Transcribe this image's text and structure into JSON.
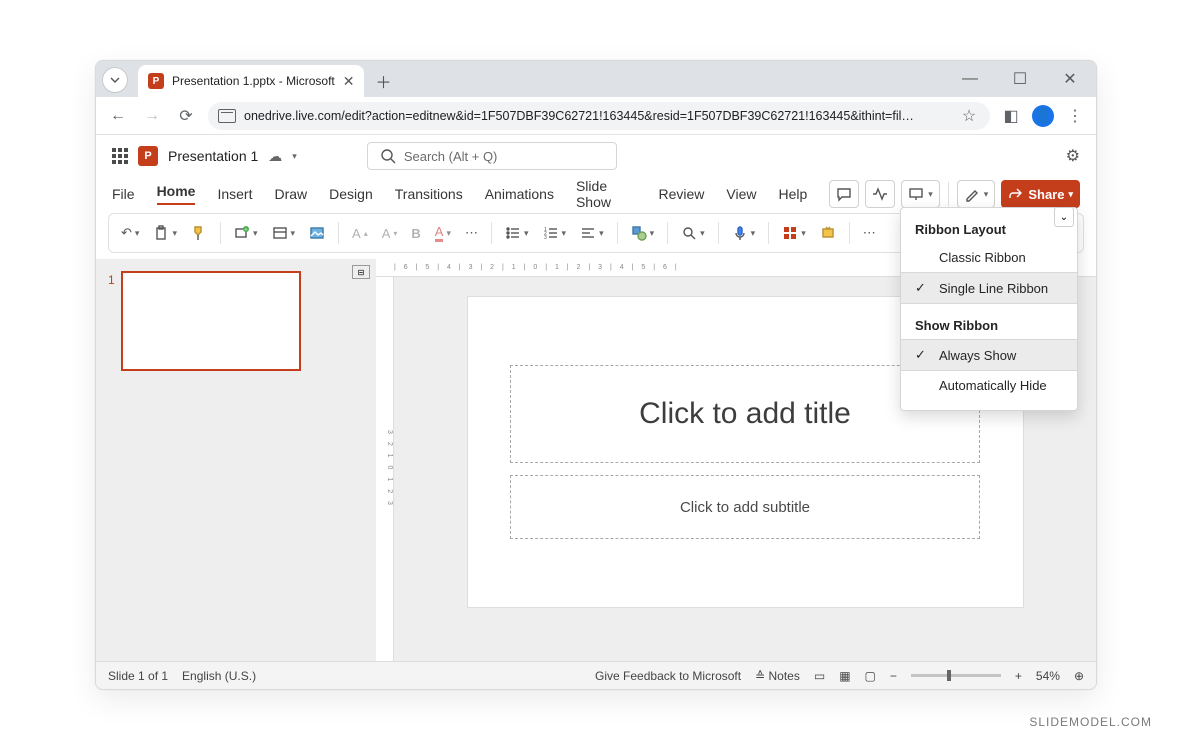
{
  "browser": {
    "tab_title": "Presentation 1.pptx - Microsoft",
    "url": "onedrive.live.com/edit?action=editnew&id=1F507DBF39C62721!163445&resid=1F507DBF39C62721!163445&ithint=fil…"
  },
  "app": {
    "doc_title": "Presentation 1",
    "search_placeholder": "Search (Alt + Q)"
  },
  "tabs": [
    "File",
    "Home",
    "Insert",
    "Draw",
    "Design",
    "Transitions",
    "Animations",
    "Slide Show",
    "Review",
    "View",
    "Help"
  ],
  "active_tab": "Home",
  "share_label": "Share",
  "slide": {
    "title_ph": "Click to add title",
    "subtitle_ph": "Click to add subtitle",
    "thumb_index": "1"
  },
  "popup": {
    "header1": "Ribbon Layout",
    "opt_classic": "Classic Ribbon",
    "opt_single": "Single Line Ribbon",
    "header2": "Show Ribbon",
    "opt_always": "Always Show",
    "opt_auto": "Automatically Hide"
  },
  "status": {
    "slide_count": "Slide 1 of 1",
    "language": "English (U.S.)",
    "feedback": "Give Feedback to Microsoft",
    "notes": "Notes",
    "zoom_pct": "54%"
  },
  "watermark": "SLIDEMODEL.COM"
}
